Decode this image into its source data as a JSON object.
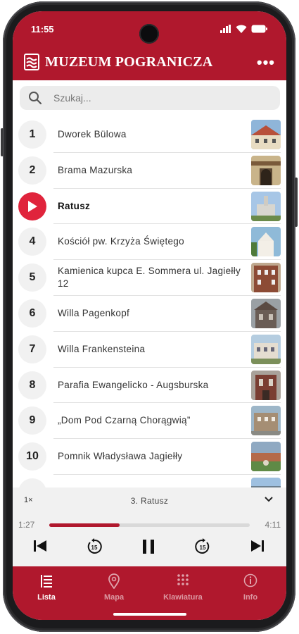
{
  "status": {
    "time": "11:55"
  },
  "header": {
    "title": "MUZEUM POGRANICZA",
    "menu": "•••"
  },
  "search": {
    "placeholder": "Szukaj..."
  },
  "items": [
    {
      "number": "1",
      "title": "Dworek Bülowa"
    },
    {
      "number": "2",
      "title": "Brama Mazurska"
    },
    {
      "number": "3",
      "title": "Ratusz",
      "playing": true
    },
    {
      "number": "4",
      "title": "Kościół pw. Krzyża Świętego"
    },
    {
      "number": "5",
      "title": "Kamienica kupca E. Sommera ul. Jagiełły 12"
    },
    {
      "number": "6",
      "title": "Willa Pagenkopf"
    },
    {
      "number": "7",
      "title": "Willa Frankensteina"
    },
    {
      "number": "8",
      "title": "Parafia Ewangelicko - Augsburska"
    },
    {
      "number": "9",
      "title": "„Dom Pod Czarną Chorągwią”"
    },
    {
      "number": "10",
      "title": "Pomnik Władysława Jagiełły"
    }
  ],
  "player": {
    "speed": "1×",
    "now_playing": "3. Ratusz",
    "elapsed": "1:27",
    "total": "4:11",
    "progress": 0.35,
    "skip_back_seconds": "15",
    "skip_forward_seconds": "15"
  },
  "nav": [
    {
      "label": "Lista",
      "icon": "list-icon",
      "selected": true
    },
    {
      "label": "Mapa",
      "icon": "map-pin-icon"
    },
    {
      "label": "Klawiatura",
      "icon": "keypad-icon"
    },
    {
      "label": "Info",
      "icon": "info-icon"
    }
  ],
  "colors": {
    "brand": "#b0182d",
    "play_accent": "#e0243c"
  }
}
